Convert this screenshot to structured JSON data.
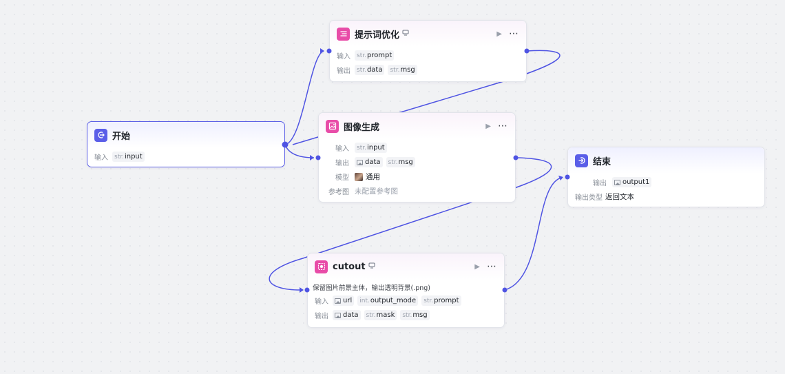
{
  "nodes": {
    "prompt_opt": {
      "title": "提示词优化",
      "input_label": "输入",
      "output_label": "输出",
      "inputs": [
        {
          "type": "str.",
          "name": "prompt"
        }
      ],
      "outputs": [
        {
          "type": "str.",
          "name": "data"
        },
        {
          "type": "str.",
          "name": "msg"
        }
      ]
    },
    "start": {
      "title": "开始",
      "input_label": "输入",
      "inputs": [
        {
          "type": "str.",
          "name": "input"
        }
      ]
    },
    "image_gen": {
      "title": "图像生成",
      "input_label": "输入",
      "output_label": "输出",
      "model_label": "模型",
      "ref_label": "参考图",
      "inputs": [
        {
          "type": "str.",
          "name": "input"
        }
      ],
      "outputs": [
        {
          "type": "image",
          "name": "data"
        },
        {
          "type": "str.",
          "name": "msg"
        }
      ],
      "model_value": "通用",
      "ref_value": "未配置参考图"
    },
    "end": {
      "title": "结束",
      "output_label": "输出",
      "output_type_label": "输出类型",
      "outputs": [
        {
          "type": "image",
          "name": "output1"
        }
      ],
      "output_type_value": "返回文本"
    },
    "cutout": {
      "title": "cutout",
      "description": "保留图片前景主体，输出透明背景(.png)",
      "input_label": "输入",
      "output_label": "输出",
      "inputs": [
        {
          "type": "image",
          "name": "url"
        },
        {
          "type": "int.",
          "name": "output_mode"
        },
        {
          "type": "str.",
          "name": "prompt"
        }
      ],
      "outputs": [
        {
          "type": "image",
          "name": "data"
        },
        {
          "type": "str.",
          "name": "mask"
        },
        {
          "type": "str.",
          "name": "msg"
        }
      ]
    }
  },
  "icons": {
    "run": "play-icon",
    "more": "more-icon",
    "version": "version-icon",
    "start": "login-icon",
    "end": "exit-icon",
    "prompt": "list-icon",
    "image": "image-icon",
    "cutout": "cutout-icon"
  },
  "colors": {
    "accent": "#4f54e3",
    "plugin_icon": "#e84ca8",
    "core_icon": "#5a5ee8",
    "edge": "#4f54e3"
  }
}
